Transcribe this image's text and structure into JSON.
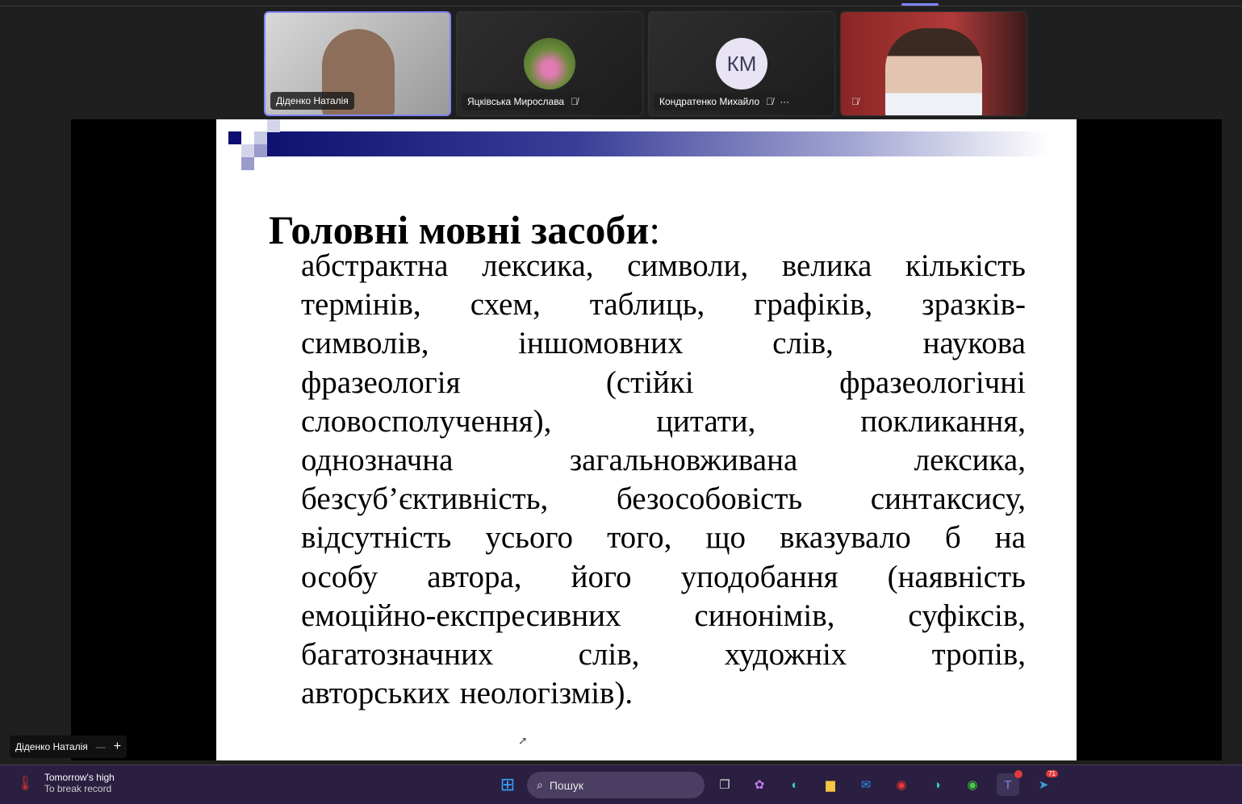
{
  "participants": [
    {
      "name": "Діденко Наталія",
      "active": true
    },
    {
      "name": "Яцківська Мирослава",
      "muted": true
    },
    {
      "name": "Кондратенко Михайло",
      "initials": "КМ",
      "muted": true,
      "more": "···"
    },
    {
      "name": "",
      "muted": true
    }
  ],
  "slide": {
    "title": "Головні мовні засоби",
    "title_colon": ":",
    "lines": [
      [
        "абстрактна",
        "лексика,",
        "символи,",
        "велика",
        "кількість"
      ],
      [
        "термінів,",
        "схем,",
        "таблиць,",
        "графіків,",
        "зразків-"
      ],
      [
        "символів,",
        "іншомовних",
        "слів,",
        "наукова"
      ],
      [
        "фразеологія",
        "(стійкі",
        "фразеологічні"
      ],
      [
        "словосполучення),",
        "цитати,",
        "покликання,"
      ],
      [
        "однозначна",
        "загальновживана",
        "лексика,"
      ],
      [
        "безсуб’єктивність,",
        "безособовість",
        "синтаксису,"
      ],
      [
        "відсутність",
        "усього",
        "того,",
        "що",
        "вказувало",
        "б",
        "на"
      ],
      [
        "особу",
        "автора,",
        "його",
        "уподобання",
        "(наявність"
      ],
      [
        "емоційно-експресивних",
        "синонімів,",
        "суфіксів,"
      ],
      [
        "багатозначних",
        "слів,",
        "художніх",
        "тропів,"
      ],
      [
        "авторських",
        "неологізмів)."
      ]
    ]
  },
  "speaker": {
    "name": "Діденко Наталія",
    "minus": "—",
    "plus": "+"
  },
  "taskbar": {
    "weather_title": "Tomorrow's high",
    "weather_sub": "To break record",
    "search_placeholder": "Пошук",
    "telegram_badge": "71"
  }
}
